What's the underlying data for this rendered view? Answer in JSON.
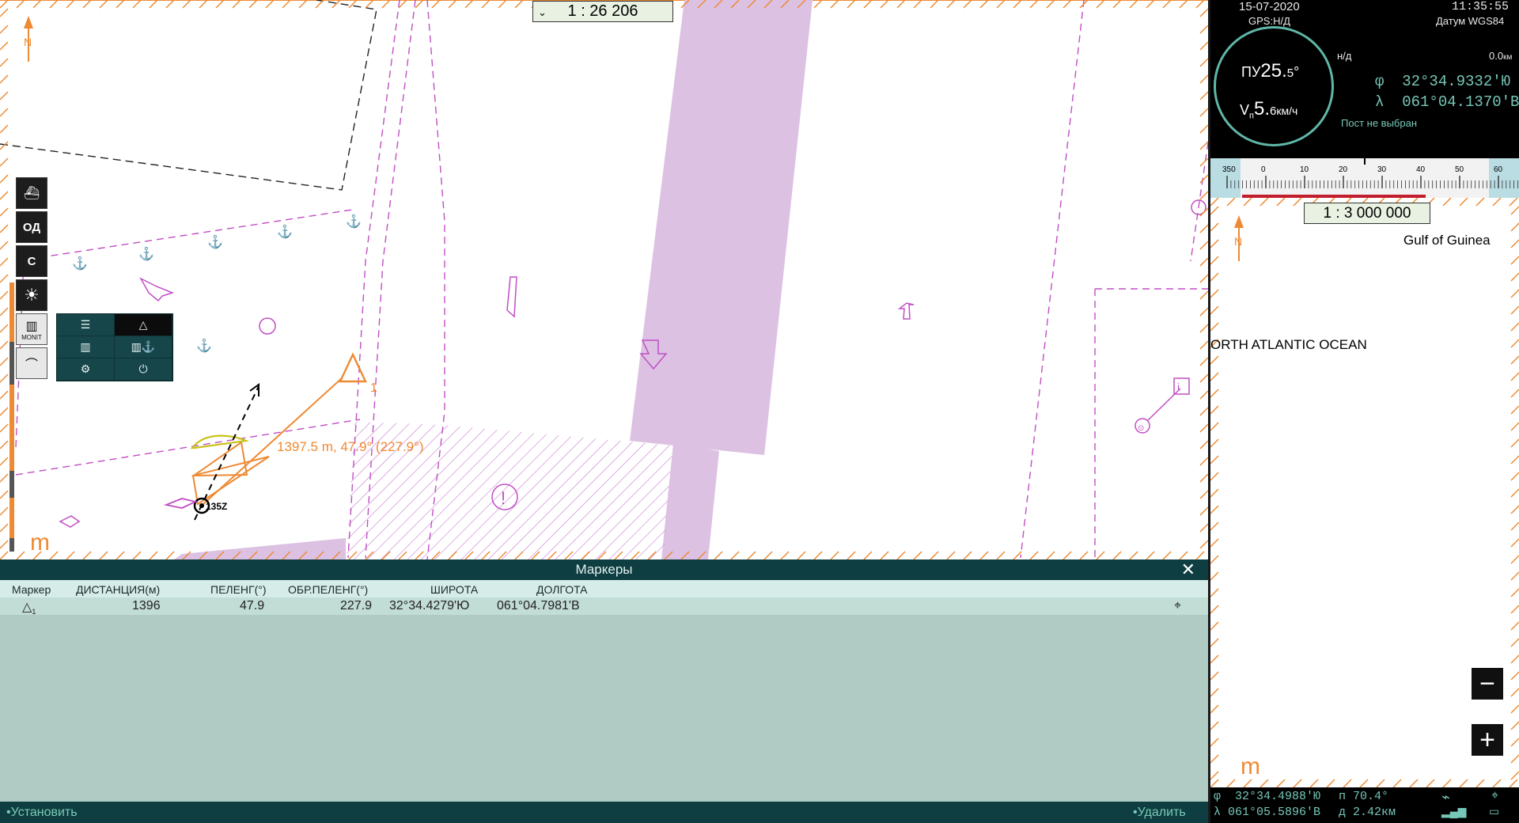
{
  "chart": {
    "scale_label": "1 :  26 206",
    "distance_label": "1397.5 m, 47.9° (227.9°)",
    "marker_index": "1",
    "target_label": "135Z",
    "mode_letter": "m",
    "toolbar": {
      "od_label": "ОД",
      "c_label": "С",
      "monit_label": "MONIT"
    }
  },
  "markers_panel": {
    "title": "Маркеры",
    "columns": [
      "Маркер",
      "ДИСТАНЦИЯ(м)",
      "ПЕЛЕНГ(°)",
      "ОБР.ПЕЛЕНГ(°)",
      "ШИРОТА",
      "ДОЛГОТА"
    ],
    "rows": [
      {
        "marker_index": "1",
        "distance": "1396",
        "bearing": "47.9",
        "reverse_bearing": "227.9",
        "latitude": "32°34.4279'Ю",
        "longitude": "061°04.7981'В"
      }
    ],
    "footer_left": "•Установить",
    "footer_right": "•Удалить"
  },
  "nav_info": {
    "date": "15-07-2020",
    "time": "11:35:55",
    "gps": "GPS:Н/Д",
    "datum": "Датум WGS84",
    "heading_prefix": "ПУ",
    "heading_main": "25.",
    "heading_dec": "5",
    "heading_unit": "°",
    "speed_prefix": "V",
    "speed_sub": "п",
    "speed_main": "5.",
    "speed_dec": "6",
    "speed_unit": "км/ч",
    "nd_label": "н/д",
    "distance_value": "0.0",
    "distance_unit": "км",
    "lat_symbol": "φ",
    "lat_value": "32°34.9332'Ю",
    "lon_symbol": "λ",
    "lon_value": "061°04.1370'В",
    "post_label": "Пост не выбран"
  },
  "compass_ruler": {
    "ticks": [
      "350",
      "0",
      "10",
      "20",
      "30",
      "40",
      "50",
      "60"
    ]
  },
  "overview": {
    "scale_label": "1 : 3 000 000",
    "label_gulf": "Gulf of Guinea",
    "label_ocean": "ORTH ATLANTIC OCEAN",
    "mode_letter": "m"
  },
  "cursor_info": {
    "lat_symbol": "φ",
    "lat_value": "32°34.4988'Ю",
    "lon_symbol": "λ",
    "lon_value": "061°05.5896'В",
    "bearing_label": "п",
    "bearing_value": "70.4°",
    "dist_label": "д",
    "dist_value": "2.42км"
  },
  "colors": {
    "orange": "#ee8a33",
    "magenta": "#c04fc4",
    "lavender": "#dcc1e3",
    "teal_dark": "#0e3e42",
    "panel": "#afcbc4"
  }
}
